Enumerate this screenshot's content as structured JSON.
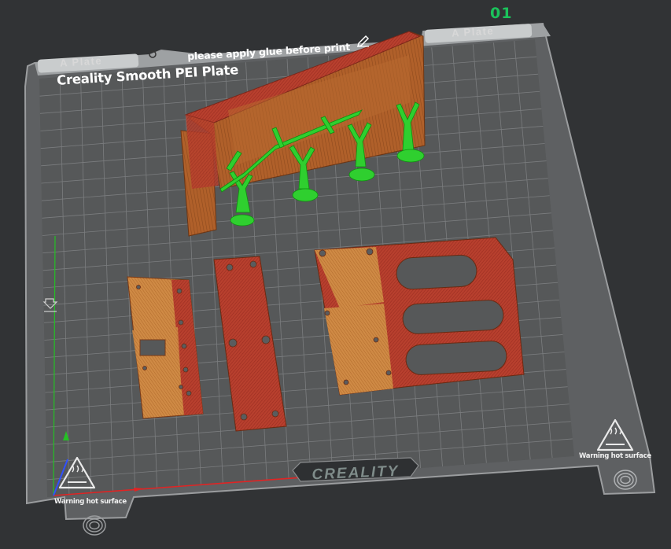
{
  "plate": {
    "index": "01",
    "tab_left": "A Plate",
    "tab_right": "A Plate",
    "name": "please apply glue before print",
    "bed_title": "Creality Smooth PEI Plate",
    "brand": "CREALITY"
  },
  "warnings": {
    "left": "Warning hot surface",
    "right": "Warning hot surface"
  },
  "colors": {
    "background": "#313335",
    "bed": "#555759",
    "grid": "#7a7c7e",
    "plate_index": "#1bc35b",
    "model_orange": "#c67a36",
    "model_red": "#b4392c",
    "support_green": "#27c52a",
    "axis_x": "#e02424",
    "axis_y": "#24c024",
    "axis_z": "#3050ff"
  },
  "icons": [
    "edit-icon",
    "plate-settings-icon",
    "hot-surface-icon",
    "fingerprint-icon",
    "bed-anchor-icon"
  ]
}
